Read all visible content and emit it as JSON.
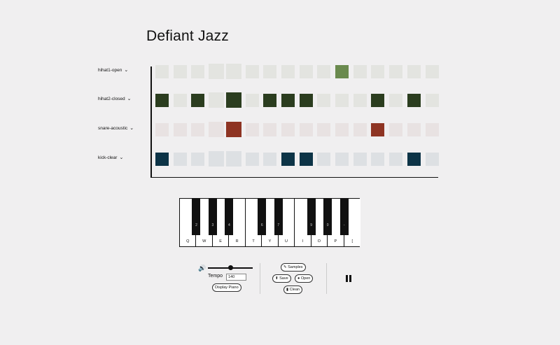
{
  "title": "Defiant Jazz",
  "tracks": [
    {
      "name": "hihat1-open",
      "color": "#6a8a4e",
      "base": "#e3e4e0",
      "active": [
        10
      ]
    },
    {
      "name": "hihat2-closed",
      "color": "#2b3d1f",
      "base": "#e3e4e0",
      "active": [
        0,
        2,
        4,
        6,
        7,
        8,
        12,
        14
      ]
    },
    {
      "name": "snare-acoustic",
      "color": "#8e3423",
      "base": "#e8e2e2",
      "active": [
        4,
        12
      ]
    },
    {
      "name": "kick-clear",
      "color": "#0d3447",
      "base": "#dde0e3",
      "active": [
        0,
        7,
        8,
        14
      ]
    }
  ],
  "steps": 16,
  "track_chevron": "⌄",
  "piano": {
    "white_keys": [
      "Q",
      "W",
      "E",
      "R",
      "T",
      "Y",
      "U",
      "I",
      "O",
      "P",
      "["
    ],
    "black_keys": [
      "2",
      "3",
      "4",
      "6",
      "7",
      "9",
      "0",
      "-"
    ]
  },
  "controls": {
    "volume_icon": "speaker-icon",
    "volume_level": 0.5,
    "tempo_label": "Tempo",
    "tempo_value": "140",
    "display_piano_label": "Display Piano",
    "samples_label": "Samples",
    "save_label": "Save",
    "open_label": "Open",
    "clean_label": "Clean"
  }
}
